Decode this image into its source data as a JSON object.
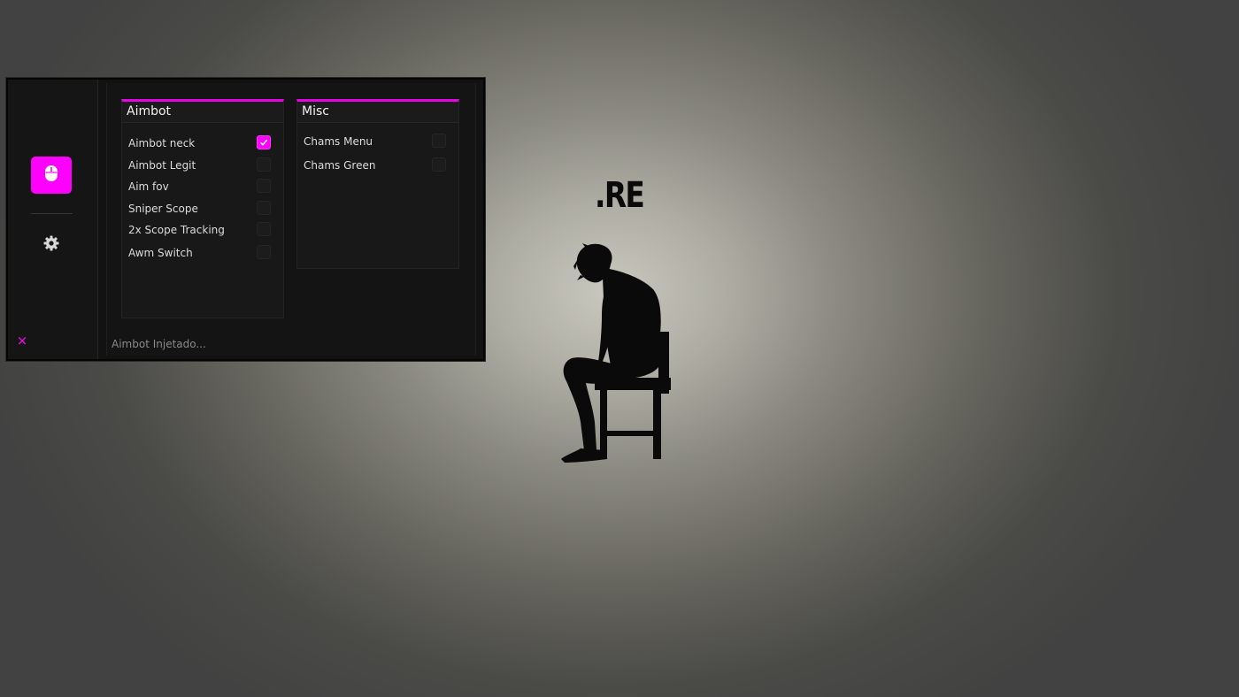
{
  "wallpaper": {
    "logo_text": ".RE",
    "figure_icon": "sitting-person-silhouette"
  },
  "menu": {
    "accent_color": "#ff00ff",
    "sidebar": {
      "items": [
        {
          "name": "aimbot-tab",
          "icon": "mouse-icon",
          "active": true
        },
        {
          "name": "settings-tab",
          "icon": "gear-icon",
          "active": false
        }
      ],
      "close_label": "×"
    },
    "groups": {
      "aimbot": {
        "title": "Aimbot",
        "options": [
          {
            "label": "Aimbot neck",
            "checked": true
          },
          {
            "label": "Aimbot Legit",
            "checked": false
          },
          {
            "label": "Aim fov",
            "checked": false
          },
          {
            "label": "Sniper Scope",
            "checked": false
          },
          {
            "label": "2x Scope Tracking",
            "checked": false
          },
          {
            "label": "Awm Switch",
            "checked": false
          }
        ]
      },
      "misc": {
        "title": "Misc",
        "options": [
          {
            "label": "Chams Menu",
            "checked": false
          },
          {
            "label": "Chams Green",
            "checked": false
          }
        ]
      }
    },
    "status": "Aimbot Injetado..."
  }
}
